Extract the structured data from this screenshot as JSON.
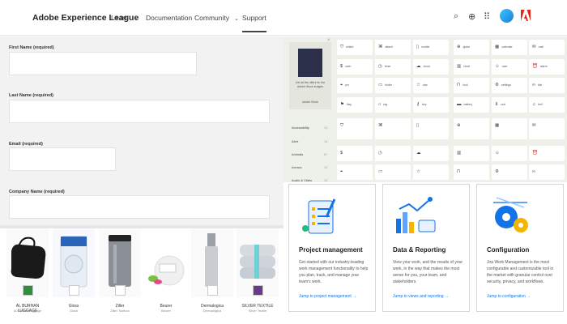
{
  "header": {
    "brand": "Adobe Experience League",
    "nav": [
      {
        "label": "Learn",
        "chevron": "⌄"
      },
      {
        "label": "Documentation",
        "chevron": ""
      },
      {
        "label": "Community",
        "chevron": "⌄"
      },
      {
        "label": "Support",
        "chevron": ""
      }
    ],
    "active_tab": "Support"
  },
  "form": {
    "fields": [
      {
        "label": "First Name (required)",
        "value": ""
      },
      {
        "label": "Last Name (required)",
        "value": ""
      },
      {
        "label": "Email (required)",
        "value": ""
      },
      {
        "label": "Company Name (required)",
        "value": ""
      }
    ]
  },
  "products": [
    {
      "name": "AL BURHAN LUGGAGE",
      "sub": "Al Burhan Luggage"
    },
    {
      "name": "Gloss",
      "sub": "Gloss"
    },
    {
      "name": "Ziller",
      "sub": "Ziller Toolbox"
    },
    {
      "name": "Beurer",
      "sub": "Beurer"
    },
    {
      "name": "Dermalogica",
      "sub": "Dermalogica"
    },
    {
      "name": "SILVER TEXTILE",
      "sub": "Silver Textile"
    }
  ],
  "thumb_card": {
    "text": "Get all the offers for the Adobe Stock images",
    "sub": "Adobe Stock"
  },
  "side_nav": [
    {
      "label": "Accessibility",
      "count": "12"
    },
    {
      "label": "Alert",
      "count": "14"
    },
    {
      "label": "Animals",
      "count": "6+"
    },
    {
      "label": "Arrows",
      "count": "12"
    },
    {
      "label": "Audio & Video",
      "count": "12"
    }
  ],
  "icon_tiles": [
    "shield",
    "attach",
    "mobile",
    "globe",
    "calendar",
    "mail",
    "cash",
    "timer",
    "cloud",
    "chart",
    "user",
    "alarm",
    "pin",
    "folder",
    "star",
    "lock",
    "settings",
    "link",
    "flag",
    "tag",
    "key",
    "battery",
    "cart",
    "bell"
  ],
  "feature_cards": [
    {
      "title": "Project management",
      "body": "Get started with our industry-leading work management functionality to help you plan, track, and manage your team's work.",
      "link": "Jump to project management →"
    },
    {
      "title": "Data & Reporting",
      "body": "View your work, and the results of your work, in the way that makes the most sense for you, your team, and stakeholders.",
      "link": "Jump to views and reporting →"
    },
    {
      "title": "Configuration",
      "body": "Jira Work Management is the most configurable and customizable tool in the market with granular control over security, privacy, and workflows.",
      "link": "Jump to configuration →"
    }
  ]
}
